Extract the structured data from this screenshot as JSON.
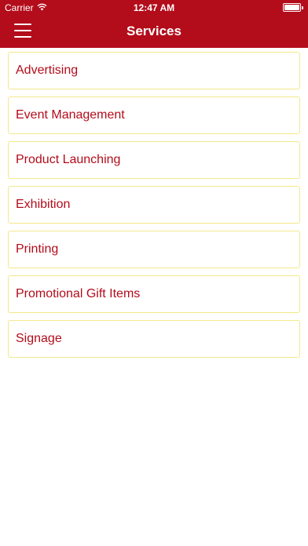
{
  "status_bar": {
    "carrier": "Carrier",
    "time": "12:47 AM",
    "wifi_icon": "wifi-icon",
    "battery_icon": "battery-icon"
  },
  "nav": {
    "title": "Services",
    "menu_icon": "hamburger-menu-icon"
  },
  "colors": {
    "brand": "#b30c1b",
    "item_border": "#f2e98a",
    "background": "#ffffff"
  },
  "services": [
    {
      "label": "Advertising"
    },
    {
      "label": "Event Management"
    },
    {
      "label": "Product Launching"
    },
    {
      "label": "Exhibition"
    },
    {
      "label": "Printing"
    },
    {
      "label": "Promotional Gift Items"
    },
    {
      "label": "Signage"
    }
  ]
}
